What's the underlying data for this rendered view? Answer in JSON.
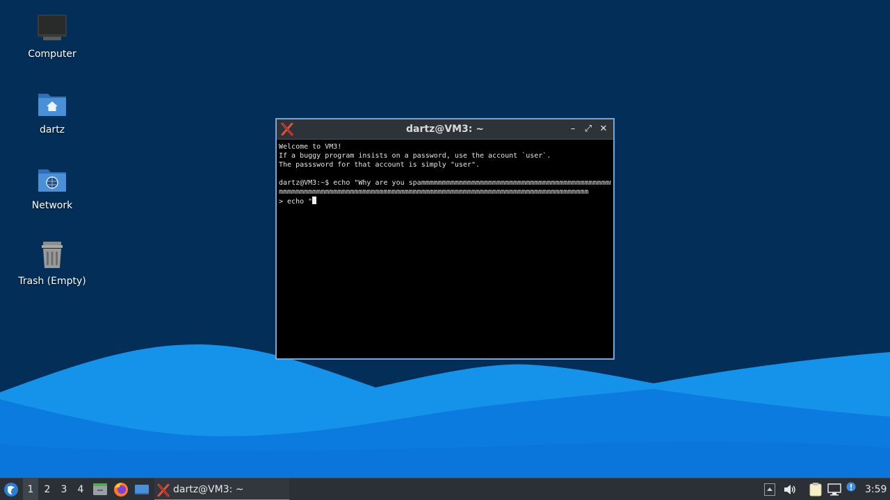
{
  "desktop": {
    "icons": [
      {
        "label": "Computer",
        "icon": "computer-icon"
      },
      {
        "label": "dartz",
        "icon": "home-folder-icon"
      },
      {
        "label": "Network",
        "icon": "network-folder-icon"
      },
      {
        "label": "Trash (Empty)",
        "icon": "trash-icon"
      }
    ]
  },
  "terminal": {
    "title": "dartz@VM3: ~",
    "app_icon": "xterm-icon",
    "controls": {
      "minimize": "–",
      "maximize": "⤢",
      "close": "✕"
    },
    "lines": [
      "Welcome to VM3!",
      "If a buggy program insists on a password, use the account `user`.",
      "The passsword for that account is simply \"user\".",
      "",
      "dartz@VM3:~$ echo \"Why are you spammmmmmmmmmmmmmmmmmmmmmmmmmmmmmmmmmmmmmmmmmmmmmmmmmm",
      "mmmmmmmmmmmmmmmmmmmmmmmmmmmmmmmmmmmmmmmmmmmmmmmmmmmmmmmmmmmmmmmmmmmmmmmmmm",
      "> echo \""
    ]
  },
  "taskbar": {
    "start_icon": "start-menu-icon",
    "workspaces": [
      "1",
      "2",
      "3",
      "4"
    ],
    "active_workspace": "1",
    "quicklaunch": [
      "file-manager-icon",
      "firefox-icon",
      "show-desktop-icon"
    ],
    "tasks": [
      {
        "label": "dartz@VM3: ~",
        "icon": "xterm-icon"
      }
    ],
    "tray": [
      "show-hidden-icons-icon",
      "volume-icon",
      "clipboard-icon",
      "network-icon",
      "update-notifier-icon"
    ],
    "clock": "3:59"
  },
  "colors": {
    "wallpaper_dark": "#032e57",
    "wave_light": "#1e9bf0",
    "wave_mid": "#0b7fe0",
    "taskbar": "#2b3036",
    "window_border": "#7aa6d6"
  }
}
